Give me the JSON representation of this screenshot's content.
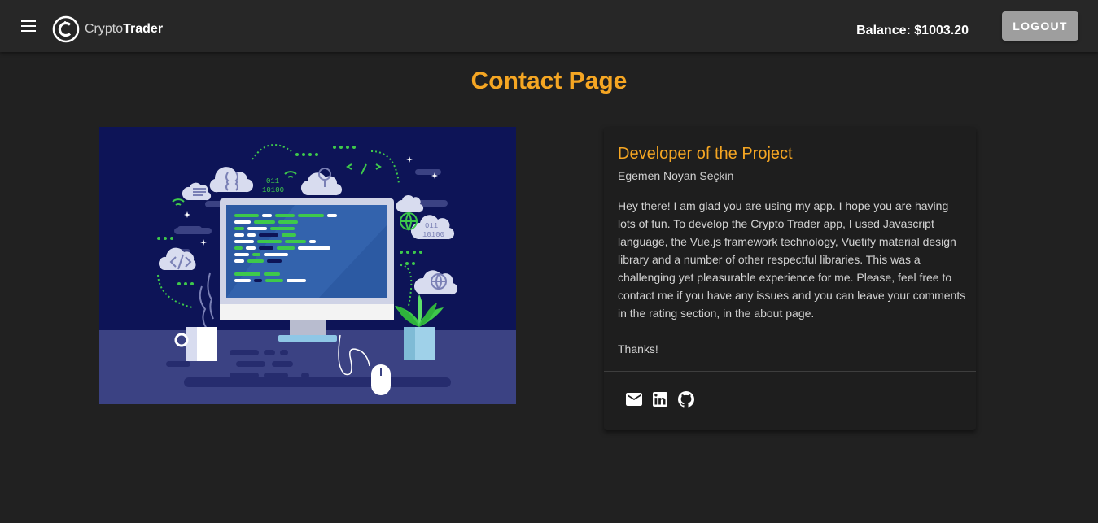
{
  "app": {
    "brand_part1": "Crypto",
    "brand_part2": "Trader",
    "balance": "Balance: $1003.20",
    "logout_label": "LOGOUT",
    "menu_icon": "hamburger-menu-icon",
    "logo_icon": "crypto-coin-logo"
  },
  "page": {
    "title": "Contact Page"
  },
  "card": {
    "title": "Developer of the Project",
    "subtitle": "Egemen Noyan Seçkin",
    "paragraph1": "Hey there! I am glad you are using my app. I hope you are having lots of fun. To develop the Crypto Trader app, I used Javascript language, the Vue.js framework technology, Vuetify material design library and a number of other respectful libraries. This was a challenging yet pleasurable experience for me. Please, feel free to contact me if you have any issues and you can leave your comments in the rating section, in the about page.",
    "paragraph2": "Thanks!",
    "icons": [
      "email-icon",
      "linkedin-icon",
      "github-icon"
    ]
  },
  "illustration": {
    "text_binary_top": [
      "011",
      "10100"
    ],
    "text_binary_right": [
      "011",
      "10100"
    ]
  },
  "colors": {
    "accent": "#f5a623",
    "background": "#212121",
    "appbar": "#272727",
    "card": "#1e1e1e",
    "logout_button": "#9e9e9e",
    "illustration_bg": "#0d1457",
    "illustration_floor": "#3b4283",
    "code_green": "#3ec94b"
  }
}
